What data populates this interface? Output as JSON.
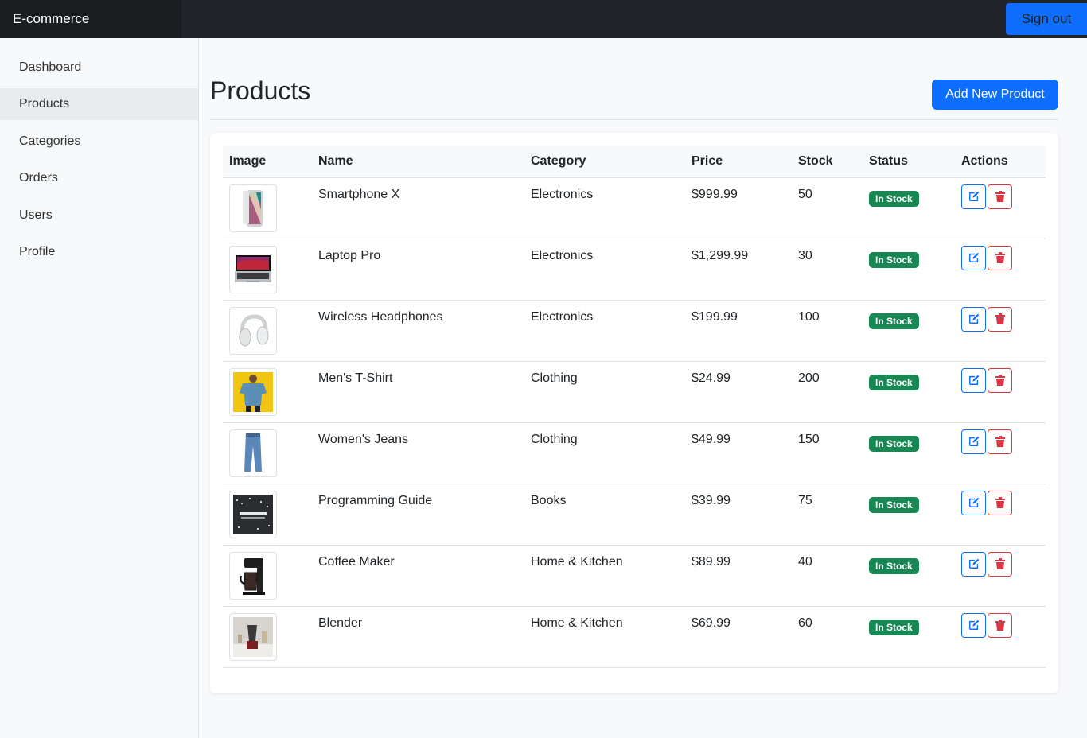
{
  "navbar": {
    "brand": "E-commerce",
    "signout_label": "Sign out"
  },
  "sidebar": {
    "items": [
      {
        "label": "Dashboard",
        "active": false
      },
      {
        "label": "Products",
        "active": true
      },
      {
        "label": "Categories",
        "active": false
      },
      {
        "label": "Orders",
        "active": false
      },
      {
        "label": "Users",
        "active": false
      },
      {
        "label": "Profile",
        "active": false
      }
    ]
  },
  "main": {
    "title": "Products",
    "add_button_label": "Add New Product",
    "table": {
      "headers": [
        "Image",
        "Name",
        "Category",
        "Price",
        "Stock",
        "Status",
        "Actions"
      ],
      "rows": [
        {
          "image": "smartphone-image",
          "name": "Smartphone X",
          "category": "Electronics",
          "price": "$999.99",
          "stock": "50",
          "status": "In Stock"
        },
        {
          "image": "laptop-image",
          "name": "Laptop Pro",
          "category": "Electronics",
          "price": "$1,299.99",
          "stock": "30",
          "status": "In Stock"
        },
        {
          "image": "headphones-image",
          "name": "Wireless Headphones",
          "category": "Electronics",
          "price": "$199.99",
          "stock": "100",
          "status": "In Stock"
        },
        {
          "image": "tshirt-image",
          "name": "Men's T-Shirt",
          "category": "Clothing",
          "price": "$24.99",
          "stock": "200",
          "status": "In Stock"
        },
        {
          "image": "jeans-image",
          "name": "Women's Jeans",
          "category": "Clothing",
          "price": "$49.99",
          "stock": "150",
          "status": "In Stock"
        },
        {
          "image": "book-image",
          "name": "Programming Guide",
          "category": "Books",
          "price": "$39.99",
          "stock": "75",
          "status": "In Stock"
        },
        {
          "image": "coffee-maker-image",
          "name": "Coffee Maker",
          "category": "Home & Kitchen",
          "price": "$89.99",
          "stock": "40",
          "status": "In Stock"
        },
        {
          "image": "blender-image",
          "name": "Blender",
          "category": "Home & Kitchen",
          "price": "$69.99",
          "stock": "60",
          "status": "In Stock"
        }
      ]
    }
  },
  "colors": {
    "primary": "#0d6efd",
    "danger": "#dc3545",
    "success": "#198754",
    "navbar": "#212529"
  }
}
